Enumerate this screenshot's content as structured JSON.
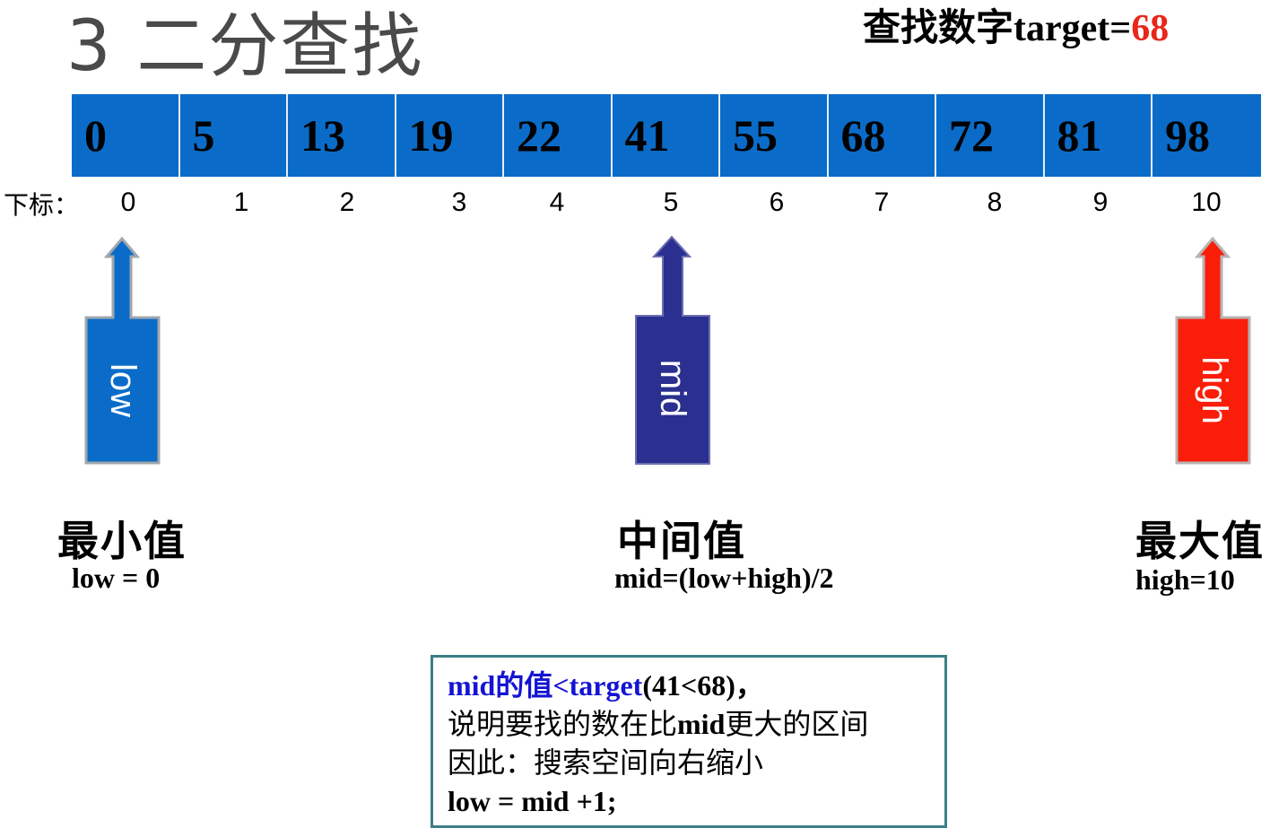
{
  "title": "3 二分查找",
  "target": {
    "prefix": "查找数字target=",
    "value": "68",
    "value_color": "#e8261a"
  },
  "array": {
    "values": [
      "0",
      "5",
      "13",
      "19",
      "22",
      "41",
      "55",
      "68",
      "72",
      "81",
      "98"
    ],
    "index_label": "下标：",
    "indices": [
      "0",
      "1",
      "2",
      "3",
      "4",
      "5",
      "6",
      "7",
      "8",
      "9",
      "10"
    ],
    "cell_color": "#0a6cc8"
  },
  "pointers": {
    "low": {
      "label": "low",
      "color": "#0a6cc8",
      "caption": "最小值",
      "formula": "low = 0"
    },
    "mid": {
      "label": "mid",
      "color": "#2b2f8f",
      "caption": "中间值",
      "formula": "mid=(low+high)/2"
    },
    "high": {
      "label": "high",
      "color": "#fa1e0a",
      "caption": "最大值",
      "formula": "high=10"
    }
  },
  "note": {
    "line1_blue": "mid的值<target",
    "line1_rest": "(41<68)，",
    "line2_pre": "说明要找的数在比",
    "line2_bold": "mid",
    "line2_post": "更大的区间",
    "line3": "因此：搜索空间向右缩小",
    "line4": "low = mid +1;",
    "border_color": "#3a7f86"
  }
}
